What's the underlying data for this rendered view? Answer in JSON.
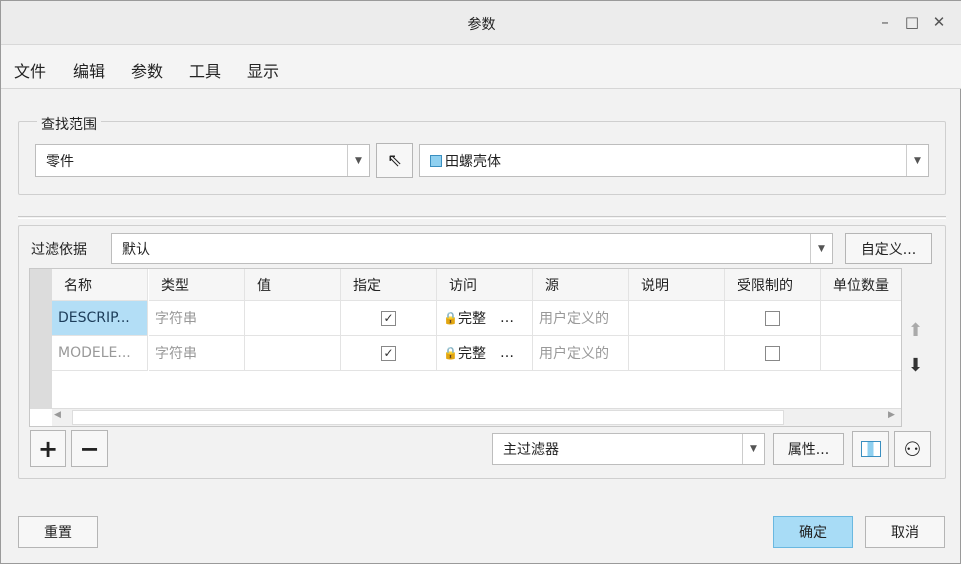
{
  "window": {
    "title": "参数",
    "minimize": "–",
    "maximize": "□",
    "close": "✕"
  },
  "menu": [
    "文件",
    "编辑",
    "参数",
    "工具",
    "显示"
  ],
  "scope": {
    "label": "查找范围",
    "type_value": "零件",
    "model_value": "田螺壳体"
  },
  "filter": {
    "label": "过滤依据",
    "value": "默认",
    "customize": "自定义..."
  },
  "table": {
    "columns": [
      "名称",
      "类型",
      "值",
      "指定",
      "访问",
      "源",
      "说明",
      "受限制的",
      "单位数量"
    ],
    "rows": [
      {
        "name": "DESCRIP...",
        "type": "字符串",
        "value": "",
        "designated": true,
        "access": "完整",
        "source": "用户定义的",
        "description": "",
        "restricted": false,
        "units": "",
        "selected": true
      },
      {
        "name": "MODELE...",
        "type": "字符串",
        "value": "",
        "designated": true,
        "access": "完整",
        "source": "用户定义的",
        "description": "",
        "restricted": false,
        "units": "",
        "selected": false
      }
    ]
  },
  "bottom_filter": {
    "value": "主过滤器",
    "properties": "属性..."
  },
  "buttons": {
    "add": "+",
    "remove": "−",
    "reset": "重置",
    "ok": "确定",
    "cancel": "取消"
  },
  "colors": {
    "accent": "#a8dcf6",
    "selected_cell": "#b3def6"
  }
}
